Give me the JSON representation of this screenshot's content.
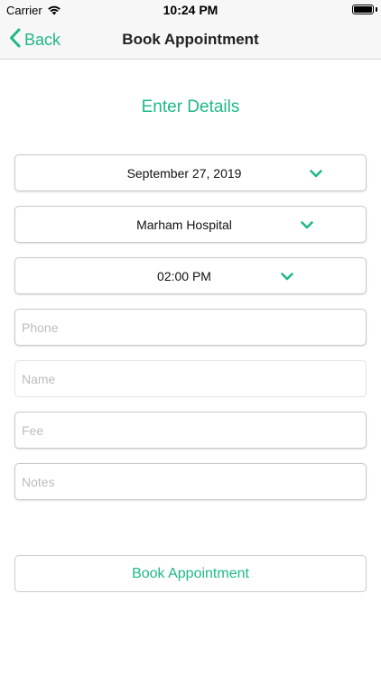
{
  "status_bar": {
    "carrier": "Carrier",
    "time": "10:24 PM",
    "wifi_icon": "wifi-icon",
    "battery_icon": "battery-icon",
    "battery_level": 1.0
  },
  "nav": {
    "back_label": "Back",
    "back_icon": "chevron-left-icon",
    "title": "Book Appointment"
  },
  "form": {
    "heading": "Enter Details",
    "date": {
      "value": "September 27, 2019",
      "icon": "chevron-down-icon"
    },
    "hospital": {
      "value": "Marham Hospital",
      "icon": "chevron-down-icon"
    },
    "time": {
      "value": "02:00 PM",
      "icon": "chevron-down-icon"
    },
    "phone": {
      "value": "",
      "placeholder": "Phone"
    },
    "name": {
      "value": "",
      "placeholder": "Name"
    },
    "fee": {
      "value": "",
      "placeholder": "Fee"
    },
    "notes": {
      "value": "",
      "placeholder": "Notes"
    },
    "submit_label": "Book Appointment"
  },
  "colors": {
    "accent": "#1fb889",
    "border": "#c9c9c9",
    "placeholder": "#bdbdbd"
  }
}
